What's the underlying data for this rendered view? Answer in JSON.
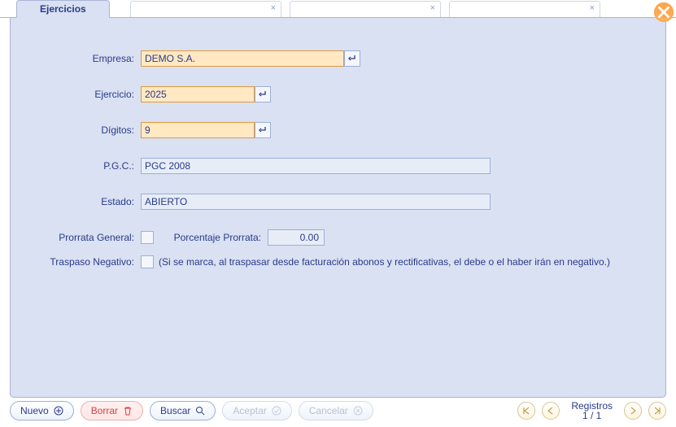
{
  "tab": {
    "title": "Ejercicios"
  },
  "form": {
    "labels": {
      "empresa": "Empresa:",
      "ejercicio": "Ejercicio:",
      "digitos": "Dígitos:",
      "pgc": "P.G.C.:",
      "estado": "Estado:",
      "prorrata_general": "Prorrata General:",
      "porcentaje_prorrata": "Porcentaje Prorrata:",
      "traspaso_negativo": "Traspaso Negativo:"
    },
    "values": {
      "empresa": "DEMO S.A.",
      "ejercicio": "2025",
      "digitos": "9",
      "pgc": "PGC 2008",
      "estado": "ABIERTO",
      "porcentaje_prorrata": "0.00"
    },
    "helper_traspaso": "(Si se marca, al traspasar desde facturación abonos y rectificativas, el debe o el haber irán en negativo.)"
  },
  "toolbar": {
    "nuevo": "Nuevo",
    "borrar": "Borrar",
    "buscar": "Buscar",
    "aceptar": "Aceptar",
    "cancelar": "Cancelar",
    "registros_label": "Registros",
    "registros_count": "1 / 1"
  }
}
